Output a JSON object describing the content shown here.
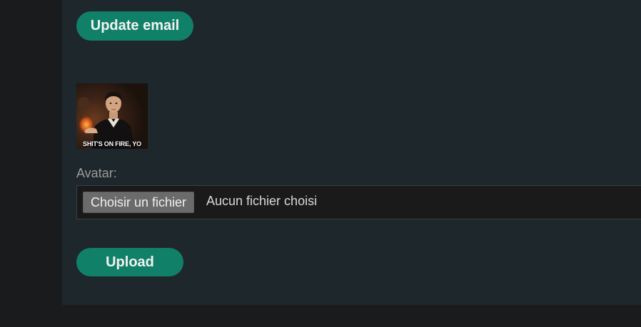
{
  "account": {
    "update_email_label": "Update email"
  },
  "avatar": {
    "caption": "SHIT'S ON FIRE, YO",
    "field_label": "Avatar:",
    "file_button_label": "Choisir un fichier",
    "file_status": "Aucun fichier choisi",
    "upload_label": "Upload"
  },
  "colors": {
    "accent": "#118068",
    "panel_bg": "#1e272c",
    "page_bg": "#1a1b1c"
  }
}
